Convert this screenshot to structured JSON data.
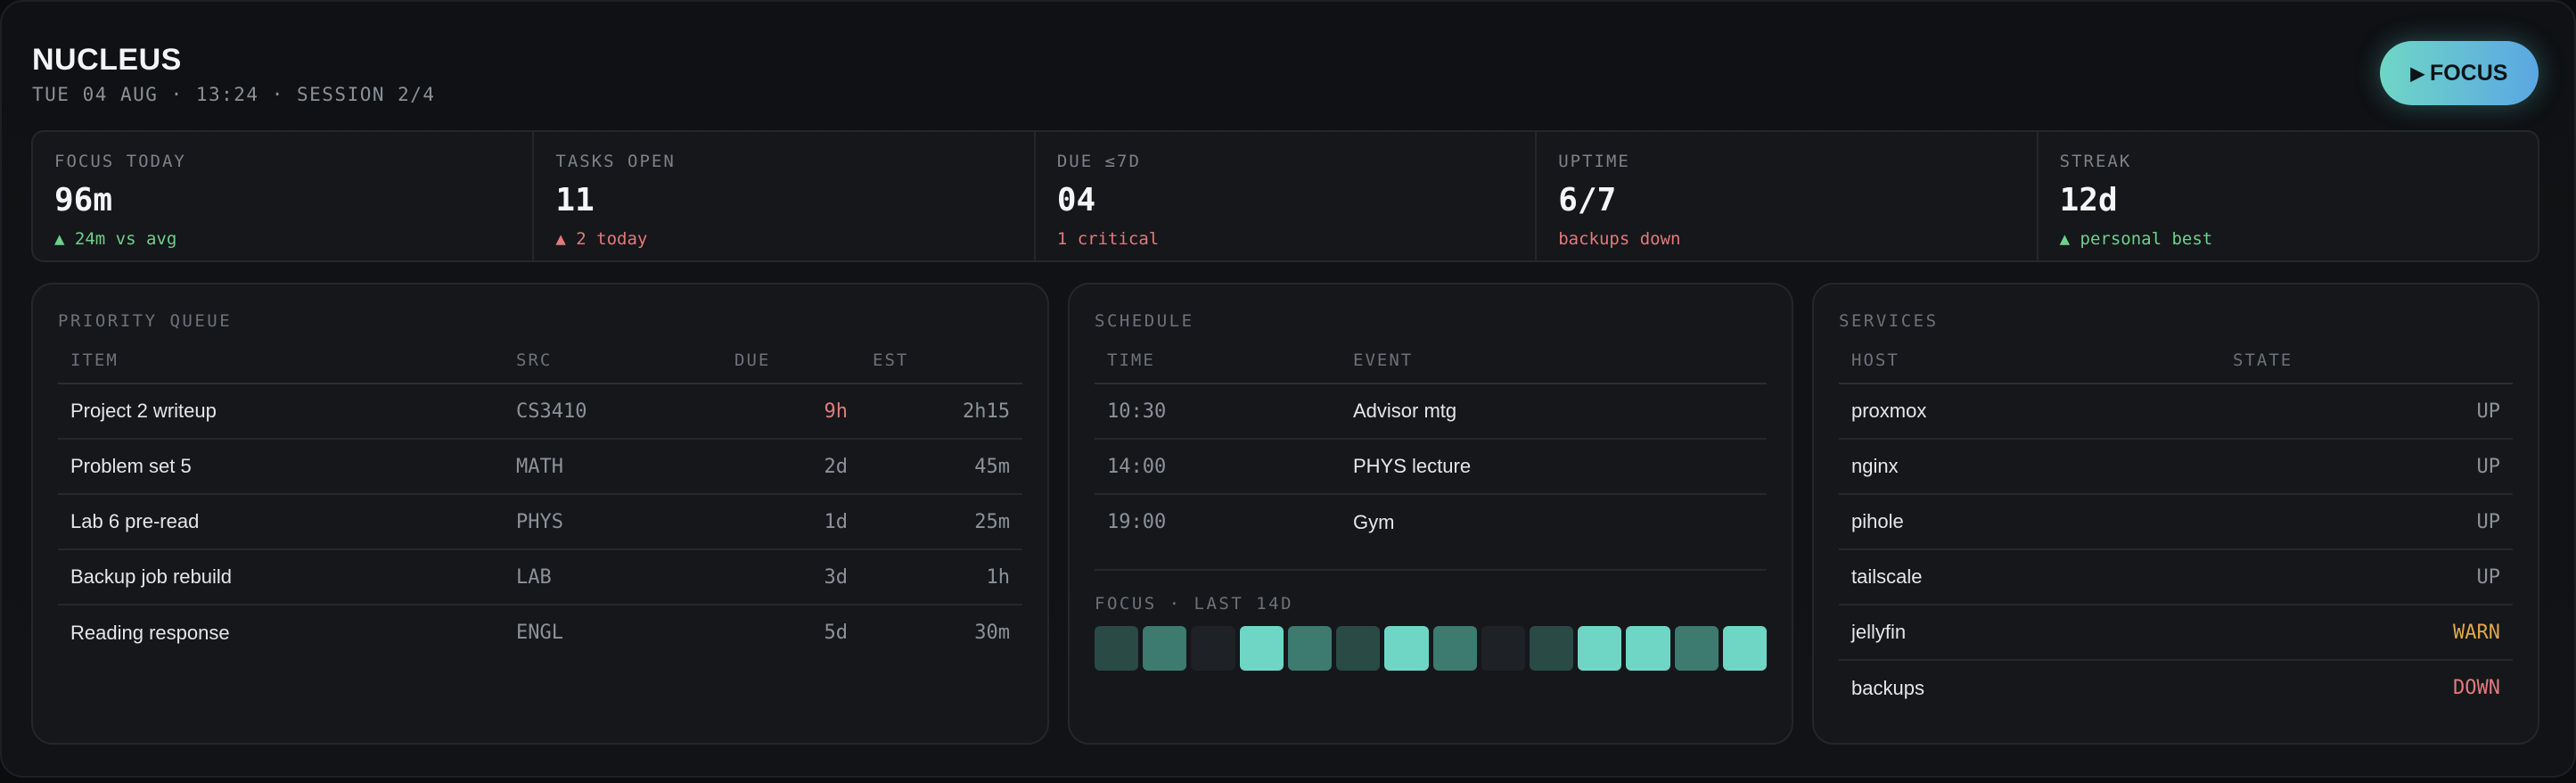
{
  "header": {
    "title": "NUCLEUS",
    "subline": "TUE 04 AUG · 13:24 · SESSION 2/4",
    "focus_button": "FOCUS",
    "focus_gradient": [
      "#6fd6c6",
      "#5aa7e3"
    ]
  },
  "stats": [
    {
      "label": "FOCUS TODAY",
      "value": "96m",
      "note": "▲ 24m vs avg",
      "tone": "up"
    },
    {
      "label": "TASKS OPEN",
      "value": "11",
      "note": "▲ 2 today",
      "tone": "warn"
    },
    {
      "label": "DUE ≤7D",
      "value": "04",
      "note": "1 critical",
      "tone": "warn"
    },
    {
      "label": "UPTIME",
      "value": "6/7",
      "note": "backups down",
      "tone": "warn"
    },
    {
      "label": "STREAK",
      "value": "12d",
      "note": "▲ personal best",
      "tone": "up"
    }
  ],
  "priority_queue": {
    "title": "PRIORITY QUEUE",
    "columns": [
      "ITEM",
      "SRC",
      "DUE",
      "EST"
    ],
    "rows": [
      {
        "item": "Project 2 writeup",
        "src": "CS3410",
        "due": "9h",
        "est": "2h15",
        "urgent": true
      },
      {
        "item": "Problem set 5",
        "src": "MATH",
        "due": "2d",
        "est": "45m",
        "urgent": false
      },
      {
        "item": "Lab 6 pre-read",
        "src": "PHYS",
        "due": "1d",
        "est": "25m",
        "urgent": false
      },
      {
        "item": "Backup job rebuild",
        "src": "LAB",
        "due": "3d",
        "est": "1h",
        "urgent": false
      },
      {
        "item": "Reading response",
        "src": "ENGL",
        "due": "5d",
        "est": "30m",
        "urgent": false
      }
    ]
  },
  "schedule": {
    "title": "SCHEDULE",
    "columns": [
      "TIME",
      "EVENT"
    ],
    "rows": [
      {
        "time": "10:30",
        "event": "Advisor mtg"
      },
      {
        "time": "14:00",
        "event": "PHYS lecture"
      },
      {
        "time": "19:00",
        "event": "Gym"
      }
    ],
    "heatmap_title": "FOCUS · LAST 14D",
    "heatmap_levels": [
      1,
      2,
      0,
      4,
      2,
      1,
      4,
      2,
      0,
      1,
      4,
      4,
      2,
      4
    ],
    "heatmap_colors": [
      "#1e2125",
      "#2a4a45",
      "#3d7a70",
      "#55a898",
      "#6fd6c6"
    ]
  },
  "services": {
    "title": "SERVICES",
    "columns": [
      "HOST",
      "STATE"
    ],
    "rows": [
      {
        "host": "proxmox",
        "state": "UP"
      },
      {
        "host": "nginx",
        "state": "UP"
      },
      {
        "host": "pihole",
        "state": "UP"
      },
      {
        "host": "tailscale",
        "state": "UP"
      },
      {
        "host": "jellyfin",
        "state": "WARN"
      },
      {
        "host": "backups",
        "state": "DOWN"
      }
    ]
  }
}
